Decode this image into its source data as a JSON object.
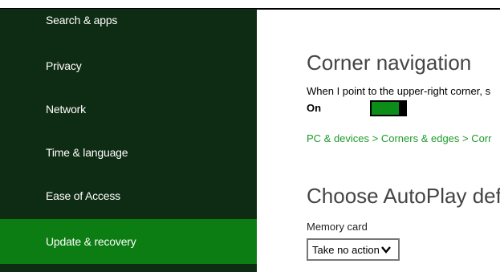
{
  "sidebar": {
    "items": [
      {
        "label": "Search & apps",
        "selected": false
      },
      {
        "label": "Privacy",
        "selected": false
      },
      {
        "label": "Network",
        "selected": false
      },
      {
        "label": "Time & language",
        "selected": false
      },
      {
        "label": "Ease of Access",
        "selected": false
      },
      {
        "label": "Update & recovery",
        "selected": true
      }
    ]
  },
  "corner_navigation": {
    "heading": "Corner navigation",
    "description": "When I point to the upper-right corner, s",
    "toggle_state": "On",
    "toggle_on": true,
    "link": "PC & devices > Corners & edges > Corr"
  },
  "autoplay": {
    "heading": "Choose AutoPlay defau",
    "field_label": "Memory card",
    "selected_value": "Take no action"
  },
  "colors": {
    "sidebar_bg": "#0e2b13",
    "selected_item": "#0c7d13",
    "toggle_on": "#0c8d1a",
    "link": "#1e9a2a",
    "heading": "#444444"
  },
  "icons": {
    "dropdown": "chevron-down-icon"
  }
}
